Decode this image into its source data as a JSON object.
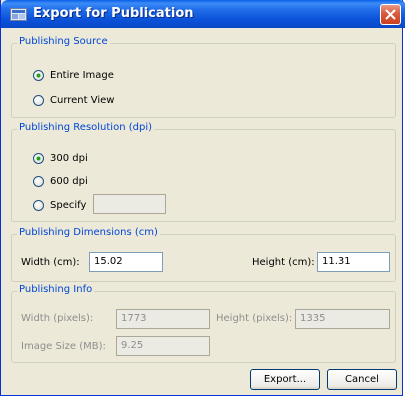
{
  "window": {
    "title": "Export for Publication",
    "close_icon": "close-icon",
    "app_icon": "window-icon"
  },
  "source": {
    "legend": "Publishing Source",
    "options": [
      {
        "label": "Entire Image",
        "selected": true
      },
      {
        "label": "Current View",
        "selected": false
      }
    ]
  },
  "resolution": {
    "legend": "Publishing Resolution (dpi)",
    "options": [
      {
        "label": "300 dpi",
        "selected": true
      },
      {
        "label": "600 dpi",
        "selected": false
      },
      {
        "label": "Specify",
        "selected": false
      }
    ],
    "specify_value": ""
  },
  "dimensions": {
    "legend": "Publishing Dimensions (cm)",
    "width_label": "Width (cm):",
    "width_value": "15.02",
    "height_label": "Height (cm):",
    "height_value": "11.31"
  },
  "info": {
    "legend": "Publishing Info",
    "width_label": "Width (pixels):",
    "width_value": "1773",
    "height_label": "Height (pixels):",
    "height_value": "1335",
    "size_label": "Image Size (MB):",
    "size_value": "9.25"
  },
  "buttons": {
    "export": "Export...",
    "cancel": "Cancel"
  },
  "colors": {
    "title_bar": "#0b52d9",
    "legend_text": "#0046d5",
    "dialog_bg": "#ece9d8",
    "radio_dot": "#21a121"
  }
}
